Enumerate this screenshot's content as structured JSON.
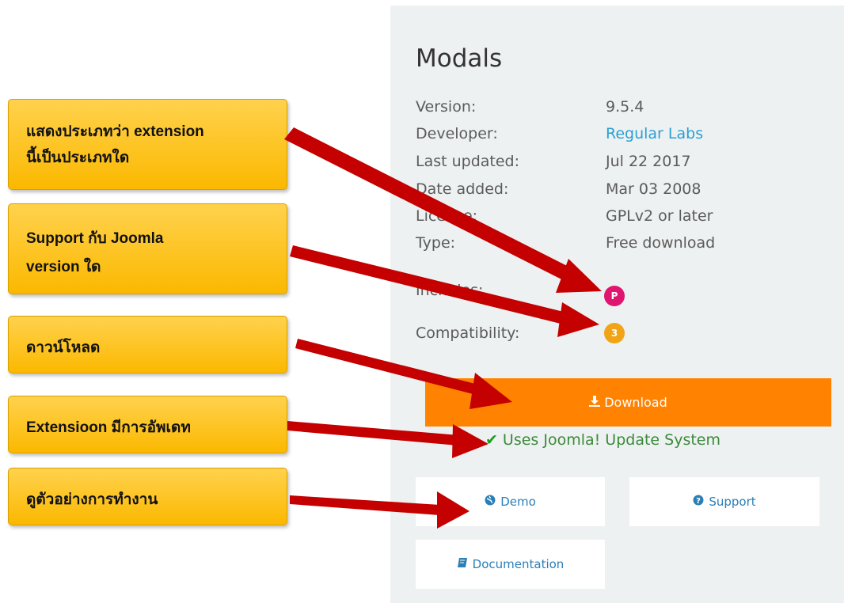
{
  "extension": {
    "title": "Modals",
    "info": [
      {
        "label": "Version:",
        "value": "9.5.4"
      },
      {
        "label": "Developer:",
        "value": "Regular Labs"
      },
      {
        "label": "Last updated:",
        "value": "Jul 22 2017"
      },
      {
        "label": "Date added:",
        "value": "Mar 03 2008"
      },
      {
        "label": "License:",
        "value": "GPLv2 or later"
      },
      {
        "label": "Type:",
        "value": "Free download"
      }
    ],
    "includes_label": "Includes:",
    "includes_badge": "P",
    "compat_label": "Compatibility:",
    "compat_badge": "3",
    "download_label": "Download",
    "update_text": "Uses Joomla! Update System",
    "demo_label": "Demo",
    "support_label": "Support",
    "documentation_label": "Documentation"
  },
  "callouts": {
    "type_line1": "แสดงประเภทว่า extension",
    "type_line2": "นี้เป็นประเภทใด",
    "support_line1": "Support กับ Joomla",
    "support_line2": "version ใด",
    "download": "ดาวน์โหลด",
    "update": "Extensioon มีการอัพเดท",
    "demo": "ดูตัวอย่างการทำงาน"
  },
  "colors": {
    "panel_bg": "#eef1f1",
    "download_bg": "#ff8300",
    "includes_badge": "#e0156f",
    "compat_badge": "#f0a416",
    "link": "#2a9fd6",
    "callout": "#fbc41a",
    "arrow": "#c40000"
  },
  "icons": {
    "download": "download-icon",
    "check": "check-icon",
    "demo": "globe-icon",
    "support": "question-circle-icon",
    "documentation": "book-icon"
  }
}
